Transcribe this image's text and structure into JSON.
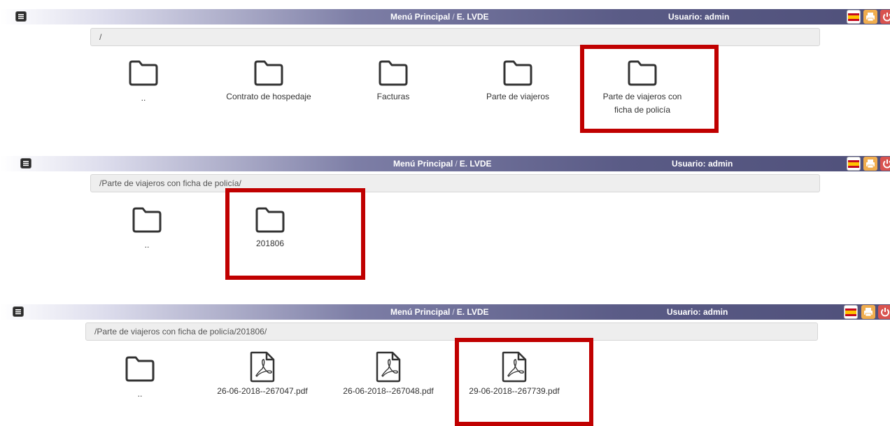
{
  "header": {
    "menu_principal": "Menú Principal",
    "separator": "/",
    "section": "E. LVDE",
    "user": "Usuario: admin"
  },
  "icons": {
    "menu": "menu-icon",
    "flag": "spain-flag-icon",
    "print": "print-icon",
    "power": "power-icon",
    "folder": "folder-icon",
    "pdf": "pdf-file-icon"
  },
  "colors": {
    "highlight": "#c00000",
    "print": "#f0ad4e",
    "power": "#d9534f"
  },
  "panels": [
    {
      "path": "/",
      "items": [
        {
          "label": "..",
          "type": "folder"
        },
        {
          "label": "Contrato de hospedaje",
          "type": "folder"
        },
        {
          "label": "Facturas",
          "type": "folder"
        },
        {
          "label": "Parte de viajeros",
          "type": "folder"
        },
        {
          "label": "Parte de viajeros con ficha de policía",
          "type": "folder",
          "highlighted": true
        }
      ]
    },
    {
      "path": "/Parte de viajeros con ficha de policía/",
      "items": [
        {
          "label": "..",
          "type": "folder"
        },
        {
          "label": "201806",
          "type": "folder",
          "highlighted": true
        }
      ]
    },
    {
      "path": "/Parte de viajeros con ficha de policía/201806/",
      "items": [
        {
          "label": "..",
          "type": "folder"
        },
        {
          "label": "26-06-2018--267047.pdf",
          "type": "pdf"
        },
        {
          "label": "26-06-2018--267048.pdf",
          "type": "pdf"
        },
        {
          "label": "29-06-2018--267739.pdf",
          "type": "pdf",
          "highlighted": true
        }
      ]
    }
  ]
}
